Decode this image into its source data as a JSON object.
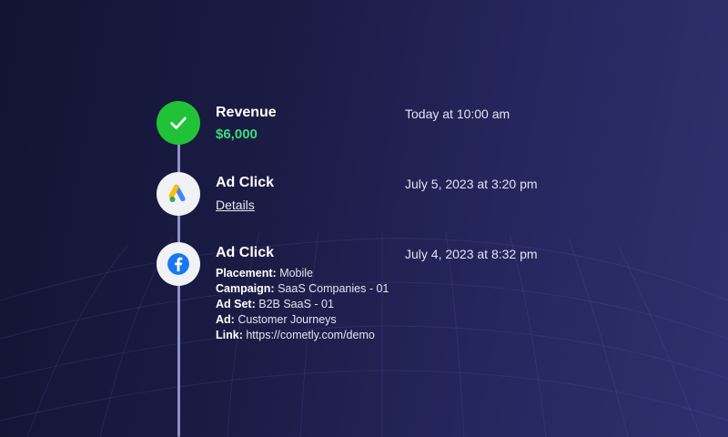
{
  "events": [
    {
      "title": "Revenue",
      "time": "Today at 10:00 am",
      "amount": "$6,000",
      "icon": "check-icon"
    },
    {
      "title": "Ad Click",
      "time": "July 5, 2023 at 3:20 pm",
      "link_label": "Details",
      "icon": "google-ads-icon"
    },
    {
      "title": "Ad Click",
      "time": "July 4, 2023 at 8:32 pm",
      "icon": "facebook-icon",
      "details": {
        "placement_label": "Placement:",
        "placement_value": "Mobile",
        "campaign_label": "Campaign:",
        "campaign_value": "SaaS Companies - 01",
        "adset_label": "Ad Set:",
        "adset_value": "B2B SaaS - 01",
        "ad_label": "Ad:",
        "ad_value": "Customer Journeys",
        "link_label": "Link:",
        "link_value": "https://cometly.com/demo"
      }
    }
  ],
  "colors": {
    "revenue_node": "#20c338",
    "revenue_amount": "#3ddc7a",
    "timeline": "#8d90c8",
    "facebook": "#1877f2"
  }
}
